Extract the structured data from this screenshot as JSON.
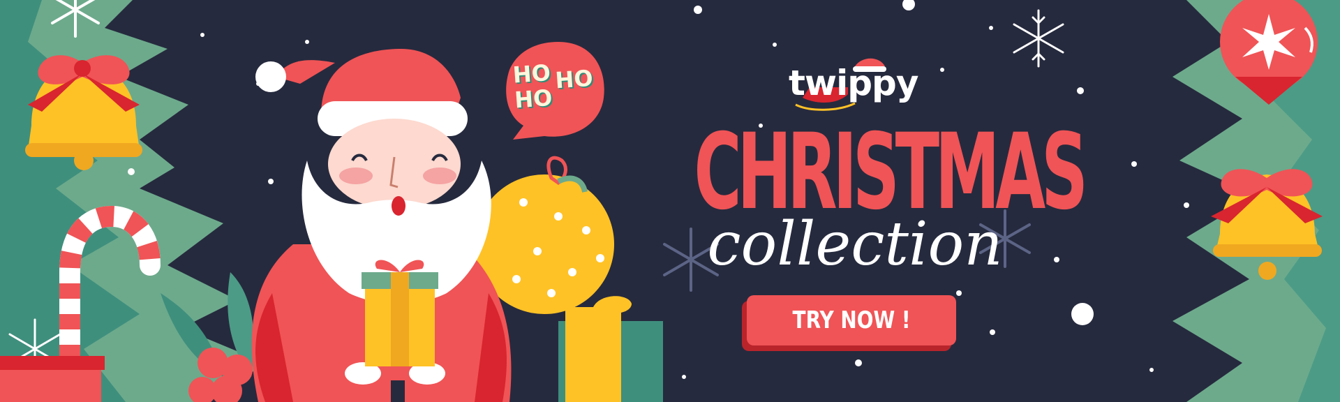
{
  "banner": {
    "hoho": [
      "HO",
      "HO",
      "HO"
    ],
    "brand": "twippy",
    "title": "CHRISTMAS",
    "subtitle": "collection",
    "cta_label": "TRY NOW !"
  },
  "colors": {
    "background": "#262a3e",
    "accent_red": "#f05456",
    "dark_red": "#d9252f",
    "tree_green": "#6daa8c",
    "gold": "#ffc226",
    "white": "#ffffff"
  },
  "icons": [
    "snowflake-icon",
    "bell-icon",
    "candy-cane-icon",
    "santa-illustration",
    "gift-icon",
    "ornament-icon",
    "holly-icon",
    "sleigh-icon"
  ]
}
